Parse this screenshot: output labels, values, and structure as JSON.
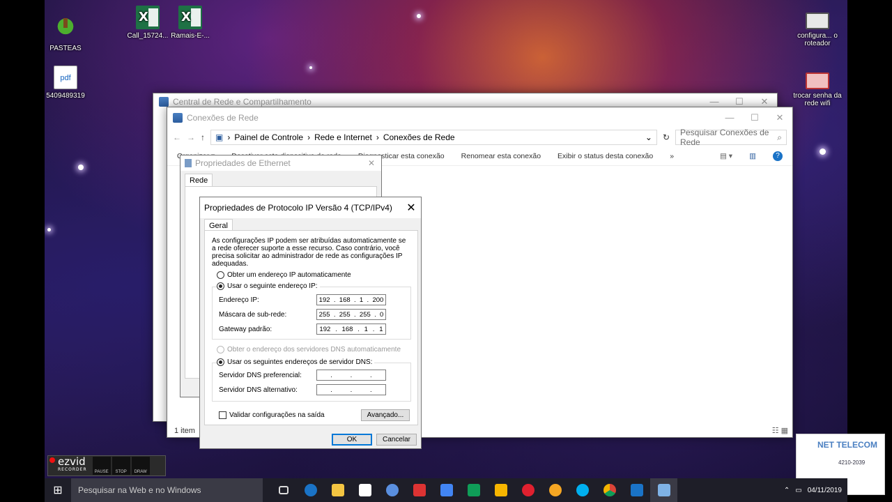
{
  "desktop_icons": [
    {
      "name": "PASTEAS",
      "icon": "tree-icon"
    },
    {
      "name": "Call_15724...",
      "icon": "excel-file-icon"
    },
    {
      "name": "Ramais-E-...",
      "icon": "excel-file-icon"
    },
    {
      "name": "5409489319",
      "icon": "pdf-file-icon"
    },
    {
      "name": "configura... o roteador",
      "icon": "monitor-icon"
    },
    {
      "name": "trocar senha da rede wifi",
      "icon": "monitor-icon"
    }
  ],
  "window_back": {
    "title": "Central de Rede e Compartilhamento"
  },
  "explorer": {
    "title": "Conexões de Rede",
    "breadcrumb": [
      "Painel de Controle",
      "Rede e Internet",
      "Conexões de Rede"
    ],
    "search_placeholder": "Pesquisar Conexões de Rede",
    "commands": [
      "Organizar ▾",
      "Desativar este dispositivo de rede",
      "Diagnosticar esta conexão",
      "Renomear esta conexão",
      "Exibir o status desta conexão",
      "»"
    ],
    "status": "1 item"
  },
  "ethernet_dialog": {
    "title": "Propriedades de Ethernet",
    "tab": "Rede"
  },
  "ipv4_dialog": {
    "title": "Propriedades de Protocolo IP Versão 4 (TCP/IPv4)",
    "tab": "Geral",
    "intro": "As configurações IP podem ser atribuídas automaticamente se a rede oferecer suporte a esse recurso. Caso contrário, você precisa solicitar ao administrador de rede as configurações IP adequadas.",
    "radio_auto_ip": "Obter um endereço IP automaticamente",
    "radio_manual_ip": "Usar o seguinte endereço IP:",
    "ip_label": "Endereço IP:",
    "ip_value": [
      "192",
      "168",
      "1",
      "200"
    ],
    "mask_label": "Máscara de sub-rede:",
    "mask_value": [
      "255",
      "255",
      "255",
      "0"
    ],
    "gateway_label": "Gateway padrão:",
    "gateway_value": [
      "192",
      "168",
      "1",
      "1"
    ],
    "radio_auto_dns": "Obter o endereço dos servidores DNS automaticamente",
    "radio_manual_dns": "Usar os seguintes endereços de servidor DNS:",
    "dns_pref_label": "Servidor DNS preferencial:",
    "dns_alt_label": "Servidor DNS alternativo:",
    "validate_label": "Validar configurações na saída",
    "advanced_button": "Avançado...",
    "ok_button": "OK",
    "cancel_button": "Cancelar"
  },
  "ezvid": {
    "logo": "ezvid",
    "sub": "RECORDER",
    "controls": [
      "PAUSE",
      "STOP",
      "DRAW"
    ]
  },
  "taskbar": {
    "search_placeholder": "Pesquisar na Web e no Windows",
    "date": "04/11/2019"
  },
  "net_widget": {
    "logo": "NET TELECOM",
    "phone": "4210-2039"
  }
}
